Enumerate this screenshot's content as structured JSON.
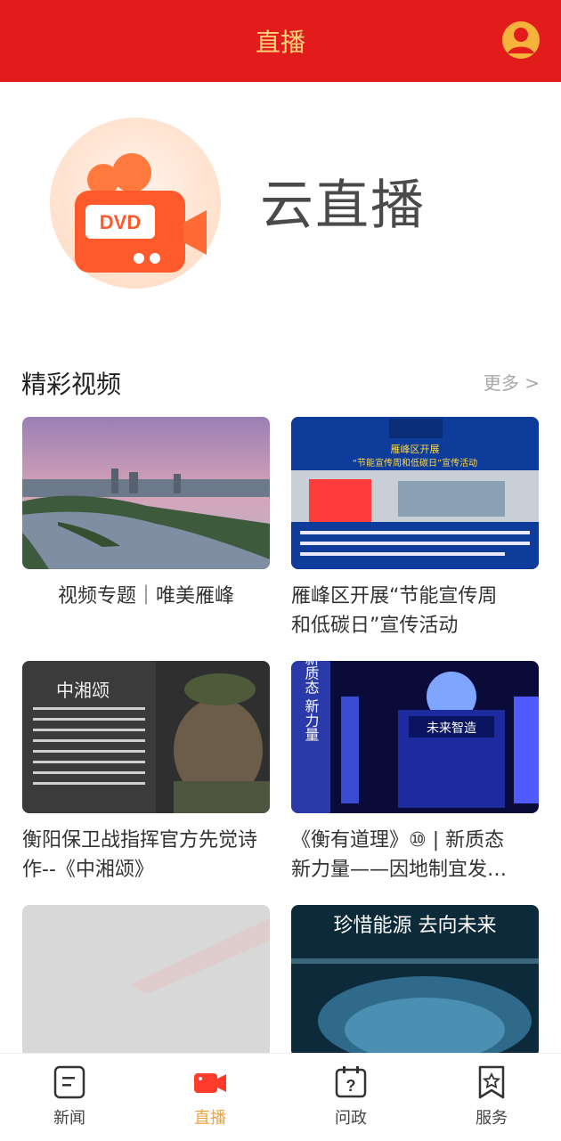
{
  "header": {
    "title": "直播"
  },
  "hero": {
    "logo_text": "DVD",
    "name": "云直播"
  },
  "section": {
    "title": "精彩视频",
    "more": "更多 >"
  },
  "videos": [
    {
      "caption": "视频专题｜唯美雁峰"
    },
    {
      "caption_line1": "雁峰区开展“节能宣传周",
      "caption_line2": "和低碳日”宣传活动",
      "thumb_text1": "雁峰区开展",
      "thumb_text2": "“节能宣传周和低碳日”宣传活动"
    },
    {
      "caption_line1": "衡阳保卫战指挥官方先觉诗",
      "caption_line2": "作--《中湘颂》",
      "thumb_title": "中湘颂"
    },
    {
      "caption_line1": "《衡有道理》⑩ | 新质态",
      "caption_line2": "新力量——因地制宜发…",
      "thumb_vertical": "新质态 新力量",
      "thumb_screen": "未来智造"
    },
    {
      "caption": ""
    },
    {
      "caption": "",
      "thumb_title": "珍惜能源 去向未来"
    }
  ],
  "tabs": [
    {
      "label": "新闻",
      "icon": "news-icon"
    },
    {
      "label": "直播",
      "icon": "live-camera-icon",
      "active": true
    },
    {
      "label": "问政",
      "icon": "question-calendar-icon"
    },
    {
      "label": "服务",
      "icon": "service-bookmark-icon"
    }
  ],
  "colors": {
    "header_bg": "#e21b1b",
    "header_text": "#ffd27a",
    "accent": "#f0a33c",
    "camera": "#ff5a2c"
  }
}
